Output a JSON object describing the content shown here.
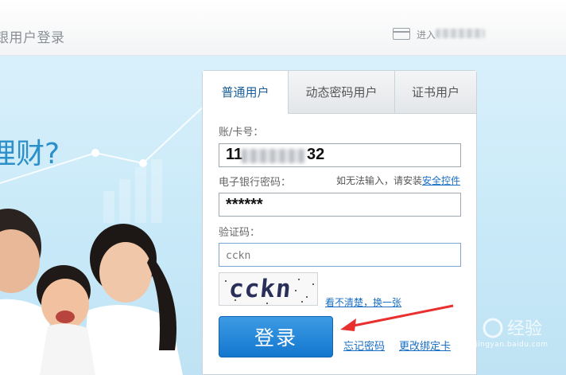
{
  "header": {
    "title": "银用户登录",
    "enter_label": "进入"
  },
  "banner": {
    "slogan": "理财?"
  },
  "tabs": [
    {
      "label": "普通用户",
      "active": true
    },
    {
      "label": "动态密码用户",
      "active": false
    },
    {
      "label": "证书用户",
      "active": false
    }
  ],
  "form": {
    "account_label": "账/卡号：",
    "account_prefix": "11",
    "account_suffix": "32",
    "password_label": "电子银行密码：",
    "password_hint": "如无法输入，请安装",
    "password_hint_link": "安全控件",
    "password_value": "******",
    "captcha_label": "验证码：",
    "captcha_value": "cckn",
    "captcha_image_text": "cckn",
    "refresh_link": "看不清楚，换一张",
    "login_button": "登录",
    "forgot_link": "忘记密码",
    "rebind_link": "更改绑定卡"
  },
  "watermark": {
    "text": "jingyan.baidu.com"
  },
  "colors": {
    "accent": "#1a6fc4",
    "button": "#1377cf",
    "annotation_arrow": "#e8302f"
  }
}
